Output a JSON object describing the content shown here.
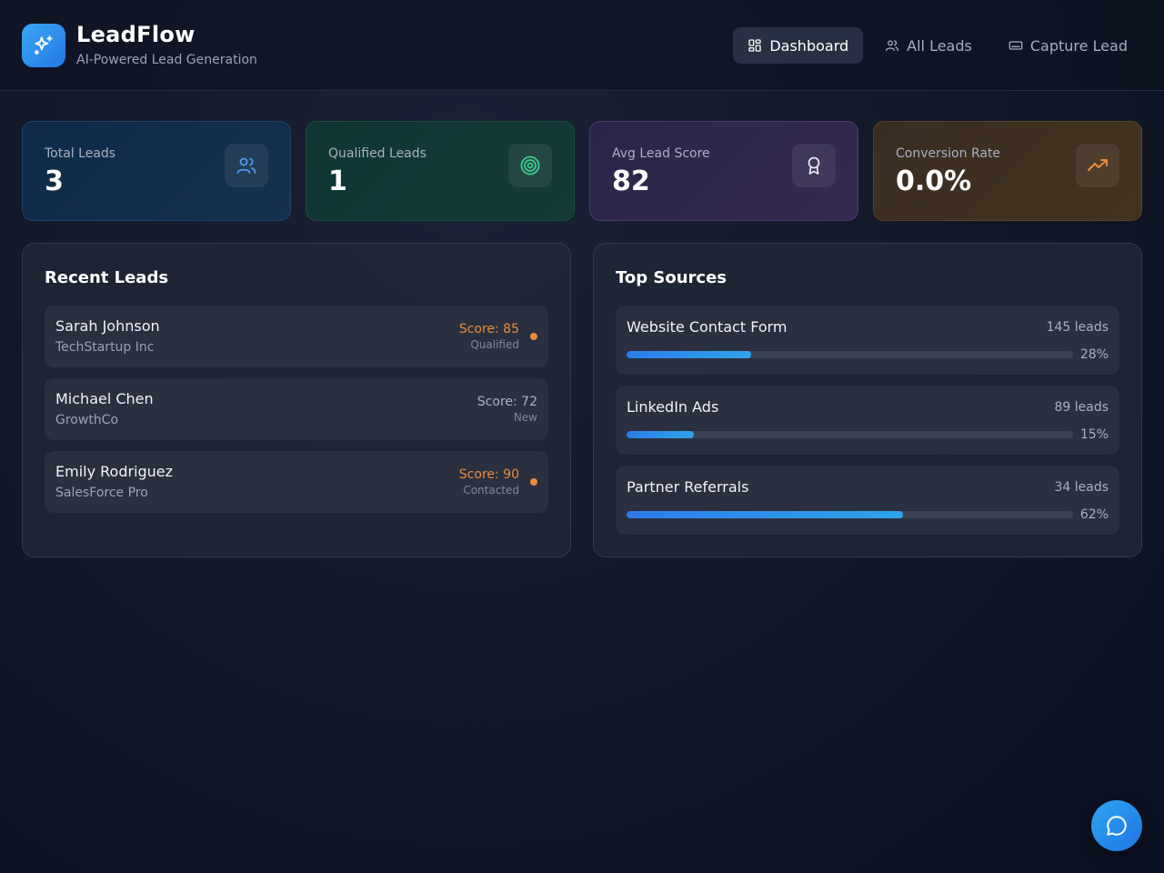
{
  "app": {
    "title": "LeadFlow",
    "subtitle": "AI-Powered Lead Generation"
  },
  "nav": {
    "items": [
      {
        "label": "Dashboard",
        "icon": "dashboard-grid-icon",
        "active": true
      },
      {
        "label": "All Leads",
        "icon": "users-icon",
        "active": false
      },
      {
        "label": "Capture Lead",
        "icon": "keyboard-icon",
        "active": false
      }
    ]
  },
  "stats": [
    {
      "label": "Total Leads",
      "value": "3",
      "icon": "users-icon",
      "color": "#4a9af0"
    },
    {
      "label": "Qualified Leads",
      "value": "1",
      "icon": "target-icon",
      "color": "#3ecf8e"
    },
    {
      "label": "Avg Lead Score",
      "value": "82",
      "icon": "award-icon",
      "color": "#e6e8ef"
    },
    {
      "label": "Conversion Rate",
      "value": "0.0%",
      "icon": "trending-up-icon",
      "color": "#ed8a3b"
    }
  ],
  "recent_leads": {
    "title": "Recent Leads",
    "items": [
      {
        "name": "Sarah Johnson",
        "company": "TechStartup Inc",
        "score": "Score: 85",
        "status": "Qualified",
        "highlight": true
      },
      {
        "name": "Michael Chen",
        "company": "GrowthCo",
        "score": "Score: 72",
        "status": "New",
        "highlight": false
      },
      {
        "name": "Emily Rodriguez",
        "company": "SalesForce Pro",
        "score": "Score: 90",
        "status": "Contacted",
        "highlight": true
      }
    ]
  },
  "top_sources": {
    "title": "Top Sources",
    "items": [
      {
        "name": "Website Contact Form",
        "count": "145 leads",
        "percent": 28,
        "percent_label": "28%"
      },
      {
        "name": "LinkedIn Ads",
        "count": "89 leads",
        "percent": 15,
        "percent_label": "15%"
      },
      {
        "name": "Partner Referrals",
        "count": "34 leads",
        "percent": 62,
        "percent_label": "62%"
      }
    ]
  },
  "colors": {
    "accent": "#2b7de9",
    "orange": "#ed8a3b"
  },
  "chat": {
    "icon": "chat-bubble-icon"
  }
}
